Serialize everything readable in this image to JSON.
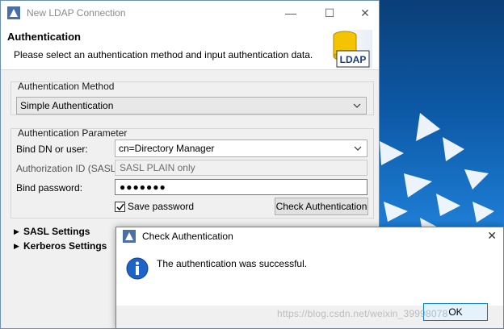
{
  "main_window": {
    "title": "New LDAP Connection",
    "controls": {
      "minimize": "—",
      "maximize": "☐",
      "close": "✕"
    }
  },
  "wizard_header": {
    "title": "Authentication",
    "description": "Please select an authentication method and input authentication data.",
    "image_label": "LDAP"
  },
  "auth_method": {
    "group_label": "Authentication Method",
    "selected": "Simple Authentication"
  },
  "auth_param": {
    "group_label": "Authentication Parameter",
    "bind_dn_label": "Bind DN or user:",
    "bind_dn_value": "cn=Directory Manager",
    "authz_id_label": "Authorization ID (SASL):",
    "authz_id_value": "SASL PLAIN only",
    "password_label": "Bind password:",
    "password_value": "●●●●●●●",
    "save_password_label": "Save password",
    "save_password_checked": true,
    "check_button": "Check Authentication"
  },
  "sections": {
    "sasl": "SASL Settings",
    "kerberos": "Kerberos Settings"
  },
  "dialog": {
    "title": "Check Authentication",
    "message": "The authentication was successful.",
    "ok": "OK",
    "close": "✕"
  },
  "watermark": "https://blog.csdn.net/weixin_39998078",
  "colors": {
    "accent": "#0078d7",
    "desktop": "#0d5aa8",
    "info_icon": "#1e64c8"
  }
}
